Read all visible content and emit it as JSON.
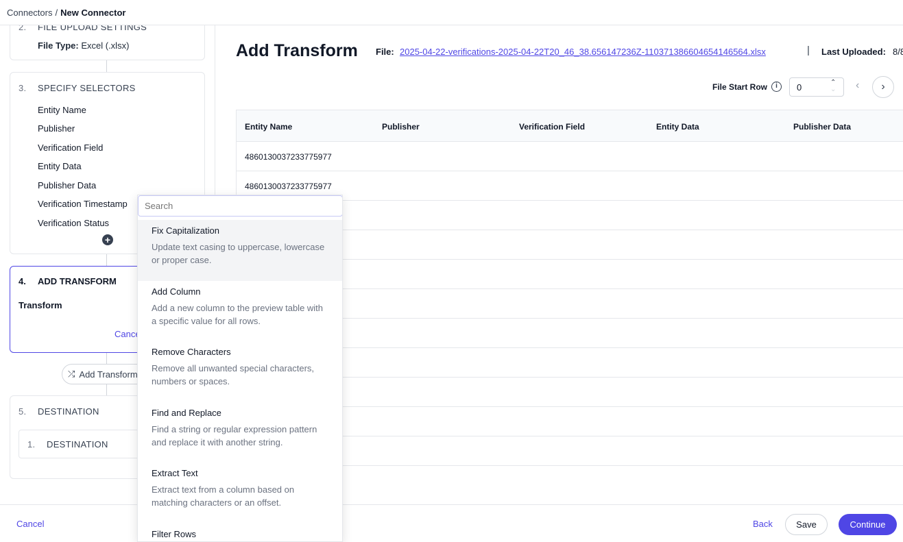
{
  "breadcrumb": {
    "root": "Connectors",
    "separator": "/",
    "current": "New Connector"
  },
  "steps": {
    "file_upload": {
      "num": "2.",
      "title": "FILE UPLOAD SETTINGS",
      "file_type_label": "File Type:",
      "file_type_value": "Excel (.xlsx)"
    },
    "selectors": {
      "num": "3.",
      "title": "SPECIFY SELECTORS",
      "items": [
        "Entity Name",
        "Publisher",
        "Verification Field",
        "Entity Data",
        "Publisher Data",
        "Verification Timestamp",
        "Verification Status"
      ]
    },
    "transform": {
      "num": "4.",
      "title": "ADD TRANSFORM",
      "label": "Transform",
      "cancel": "Cancel"
    },
    "add_transform_button": "Add Transform",
    "destination": {
      "num": "5.",
      "title": "DESTINATION",
      "sub_num": "1.",
      "sub_title": "DESTINATION"
    }
  },
  "main": {
    "title": "Add Transform",
    "file_label": "File:",
    "file_name": "2025-04-22-verifications-2025-04-22T20_46_38.656147236Z-1103713866046541465 64.xlsx",
    "last_uploaded_label": "Last Uploaded:",
    "last_uploaded_value": "8/8",
    "file_start_row_label": "File Start Row",
    "file_start_row_value": "0"
  },
  "table": {
    "columns": [
      "Entity Name",
      "Publisher",
      "Verification Field",
      "Entity Data",
      "Publisher Data"
    ],
    "rows": [
      [
        "4860130037233775977",
        "",
        "",
        "",
        ""
      ],
      [
        "4860130037233775977",
        "",
        "",
        "",
        ""
      ],
      [
        "",
        "",
        "",
        "",
        ""
      ],
      [
        "",
        "",
        "",
        "",
        ""
      ],
      [
        "",
        "",
        "",
        "",
        ""
      ],
      [
        "",
        "",
        "",
        "",
        ""
      ],
      [
        "",
        "",
        "",
        "",
        ""
      ],
      [
        "",
        "",
        "",
        "",
        ""
      ],
      [
        "",
        "",
        "",
        "",
        ""
      ],
      [
        "",
        "",
        "",
        "",
        ""
      ],
      [
        "",
        "",
        "",
        "",
        ""
      ]
    ]
  },
  "dropdown": {
    "search_placeholder": "Search",
    "items": [
      {
        "title": "Fix Capitalization",
        "desc": "Update text casing to uppercase, lowercase or proper case."
      },
      {
        "title": "Add Column",
        "desc": "Add a new column to the preview table with a specific value for all rows."
      },
      {
        "title": "Remove Characters",
        "desc": "Remove all unwanted special characters, numbers or spaces."
      },
      {
        "title": "Find and Replace",
        "desc": "Find a string or regular expression pattern and replace it with another string."
      },
      {
        "title": "Extract Text",
        "desc": "Extract text from a column based on matching characters or an offset."
      },
      {
        "title": "Filter Rows",
        "desc": ""
      }
    ]
  },
  "footer": {
    "cancel": "Cancel",
    "back": "Back",
    "save": "Save",
    "continue": "Continue"
  },
  "colors": {
    "accent": "#4f46e5"
  }
}
